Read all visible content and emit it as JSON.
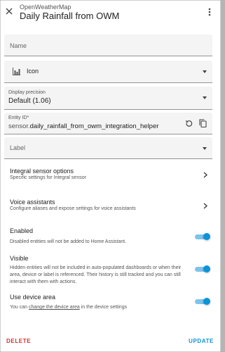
{
  "header": {
    "subtitle": "OpenWeatherMap",
    "title": "Daily Rainfall from OWM"
  },
  "fields": {
    "name": {
      "label": "Name",
      "value": ""
    },
    "icon": {
      "label": "Icon",
      "icon_name": "chart-bar-icon"
    },
    "display_precision": {
      "label": "Display precision",
      "value": "Default (1.06)"
    },
    "entity_id": {
      "label": "Entity ID*",
      "prefix": "sensor.",
      "value": "daily_rainfall_from_owm_integration_helper"
    },
    "label": {
      "label": "Label"
    }
  },
  "sections": {
    "integral": {
      "title": "Integral sensor options",
      "subtitle": "Specific settings for Integral sensor"
    },
    "voice": {
      "title": "Voice assistants",
      "subtitle": "Configure aliases and expose settings for voice assistants"
    }
  },
  "toggles": {
    "enabled": {
      "title": "Enabled",
      "subtitle": "Disabled entities will not be added to Home Assistant.",
      "on": true
    },
    "visible": {
      "title": "Visible",
      "subtitle": "Hidden entities will not be included in auto-populated dashboards or when their area, device or label is referenced. Their history is still tracked and you can still interact with them with actions.",
      "on": true
    },
    "device_area": {
      "title": "Use device area",
      "subtitle_before": "You can ",
      "link": "change the device area",
      "subtitle_after": " in the device settings",
      "on": true
    }
  },
  "footer": {
    "delete_label": "DELETE",
    "update_label": "UPDATE"
  },
  "colors": {
    "accent": "#0d93d8",
    "danger": "#d32f2f",
    "field_bg": "#f4f4f4",
    "backdrop": "#b5b5b5"
  }
}
